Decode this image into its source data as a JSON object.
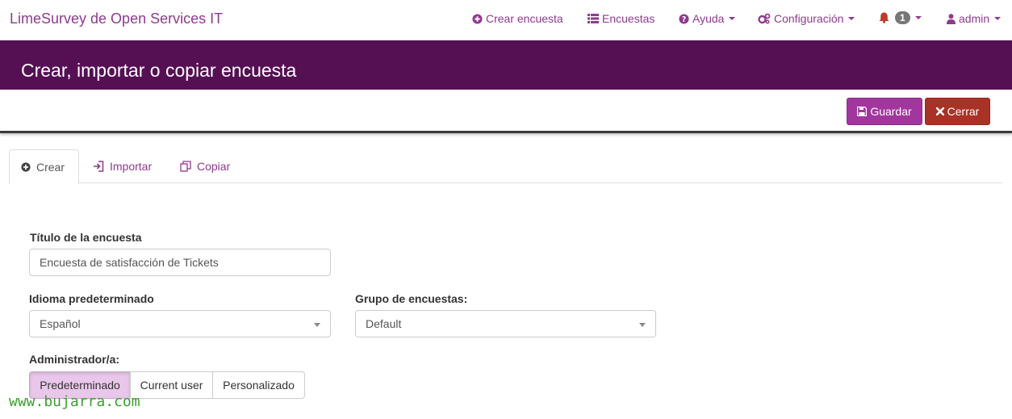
{
  "brand": "LimeSurvey de Open Services IT",
  "nav": {
    "create_survey": "Crear encuesta",
    "surveys": "Encuestas",
    "help": "Ayuda",
    "config": "Configuración",
    "notifications_count": "1",
    "user": "admin"
  },
  "page_title": "Crear, importar o copiar encuesta",
  "toolbar": {
    "save_label": "Guardar",
    "close_label": "Cerrar"
  },
  "tabs": [
    {
      "label": "Crear",
      "active": true
    },
    {
      "label": "Importar",
      "active": false
    },
    {
      "label": "Copiar",
      "active": false
    }
  ],
  "form": {
    "title_label": "Título de la encuesta",
    "title_value": "Encuesta de satisfacción de Tickets",
    "language_label": "Idioma predeterminado",
    "language_value": "Español",
    "group_label": "Grupo de encuestas:",
    "group_value": "Default",
    "admin_label": "Administrador/a:",
    "admin_options": [
      "Predeterminado",
      "Current user",
      "Personalizado"
    ],
    "admin_selected": "Predeterminado"
  },
  "watermark": "www.bujarra.com",
  "colors": {
    "brand_purple": "#8e3a8e",
    "title_bar": "#551053",
    "save_button": "#a1369d",
    "close_button": "#a93226",
    "selected_option": "#e9c7ea",
    "watermark": "#3aa12e"
  },
  "icons": {
    "create_survey": "plus-circle-icon",
    "surveys": "list-icon",
    "help": "question-circle-icon",
    "config": "cogs-icon",
    "notifications": "bell-icon",
    "user": "user-icon",
    "save": "floppy-disk-icon",
    "close": "close-icon",
    "tab_create": "plus-circle-icon",
    "tab_import": "sign-in-icon",
    "tab_copy": "copy-icon"
  }
}
